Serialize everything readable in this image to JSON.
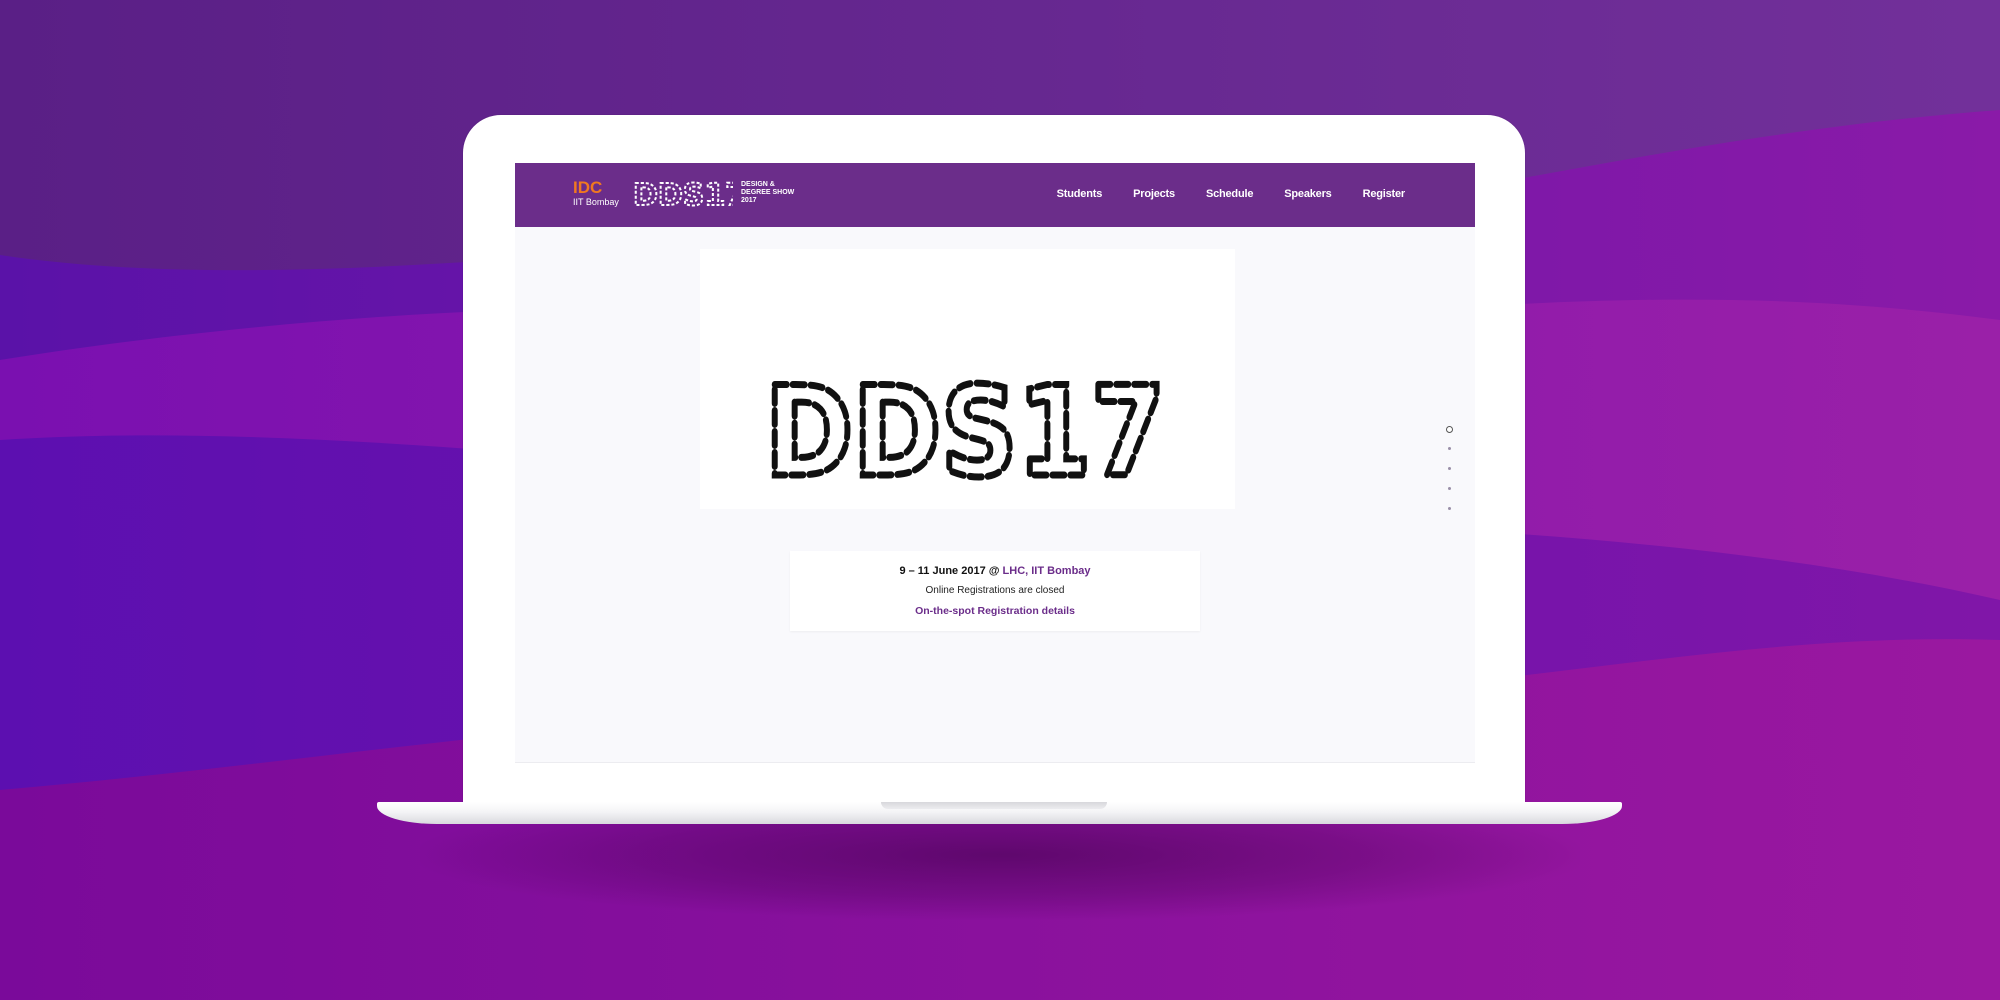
{
  "brand": {
    "org": "IDC",
    "institute": "IIT Bombay",
    "logo_text": "DDS17",
    "show_line1": "DESIGN &",
    "show_line2": "DEGREE SHOW",
    "show_line3": "2017"
  },
  "nav": {
    "items": [
      "Students",
      "Projects",
      "Schedule",
      "Speakers",
      "Register"
    ]
  },
  "hero": {
    "logo_text": "DDS17"
  },
  "info": {
    "dates": "9 – 11 June 2017 @ ",
    "venue": "LHC, IIT Bombay",
    "registration_status": "Online Registrations are closed",
    "spot_link": "On-the-spot Registration details"
  },
  "pager": {
    "active_index": 0,
    "total": 5
  },
  "colors": {
    "navbar": "#6b2d8a",
    "accent_orange": "#f07820",
    "link_purple": "#6b2d8a",
    "background_purple": "#6a2a9a"
  },
  "icons": {
    "logo": "dds17-fingerprint-logo"
  }
}
